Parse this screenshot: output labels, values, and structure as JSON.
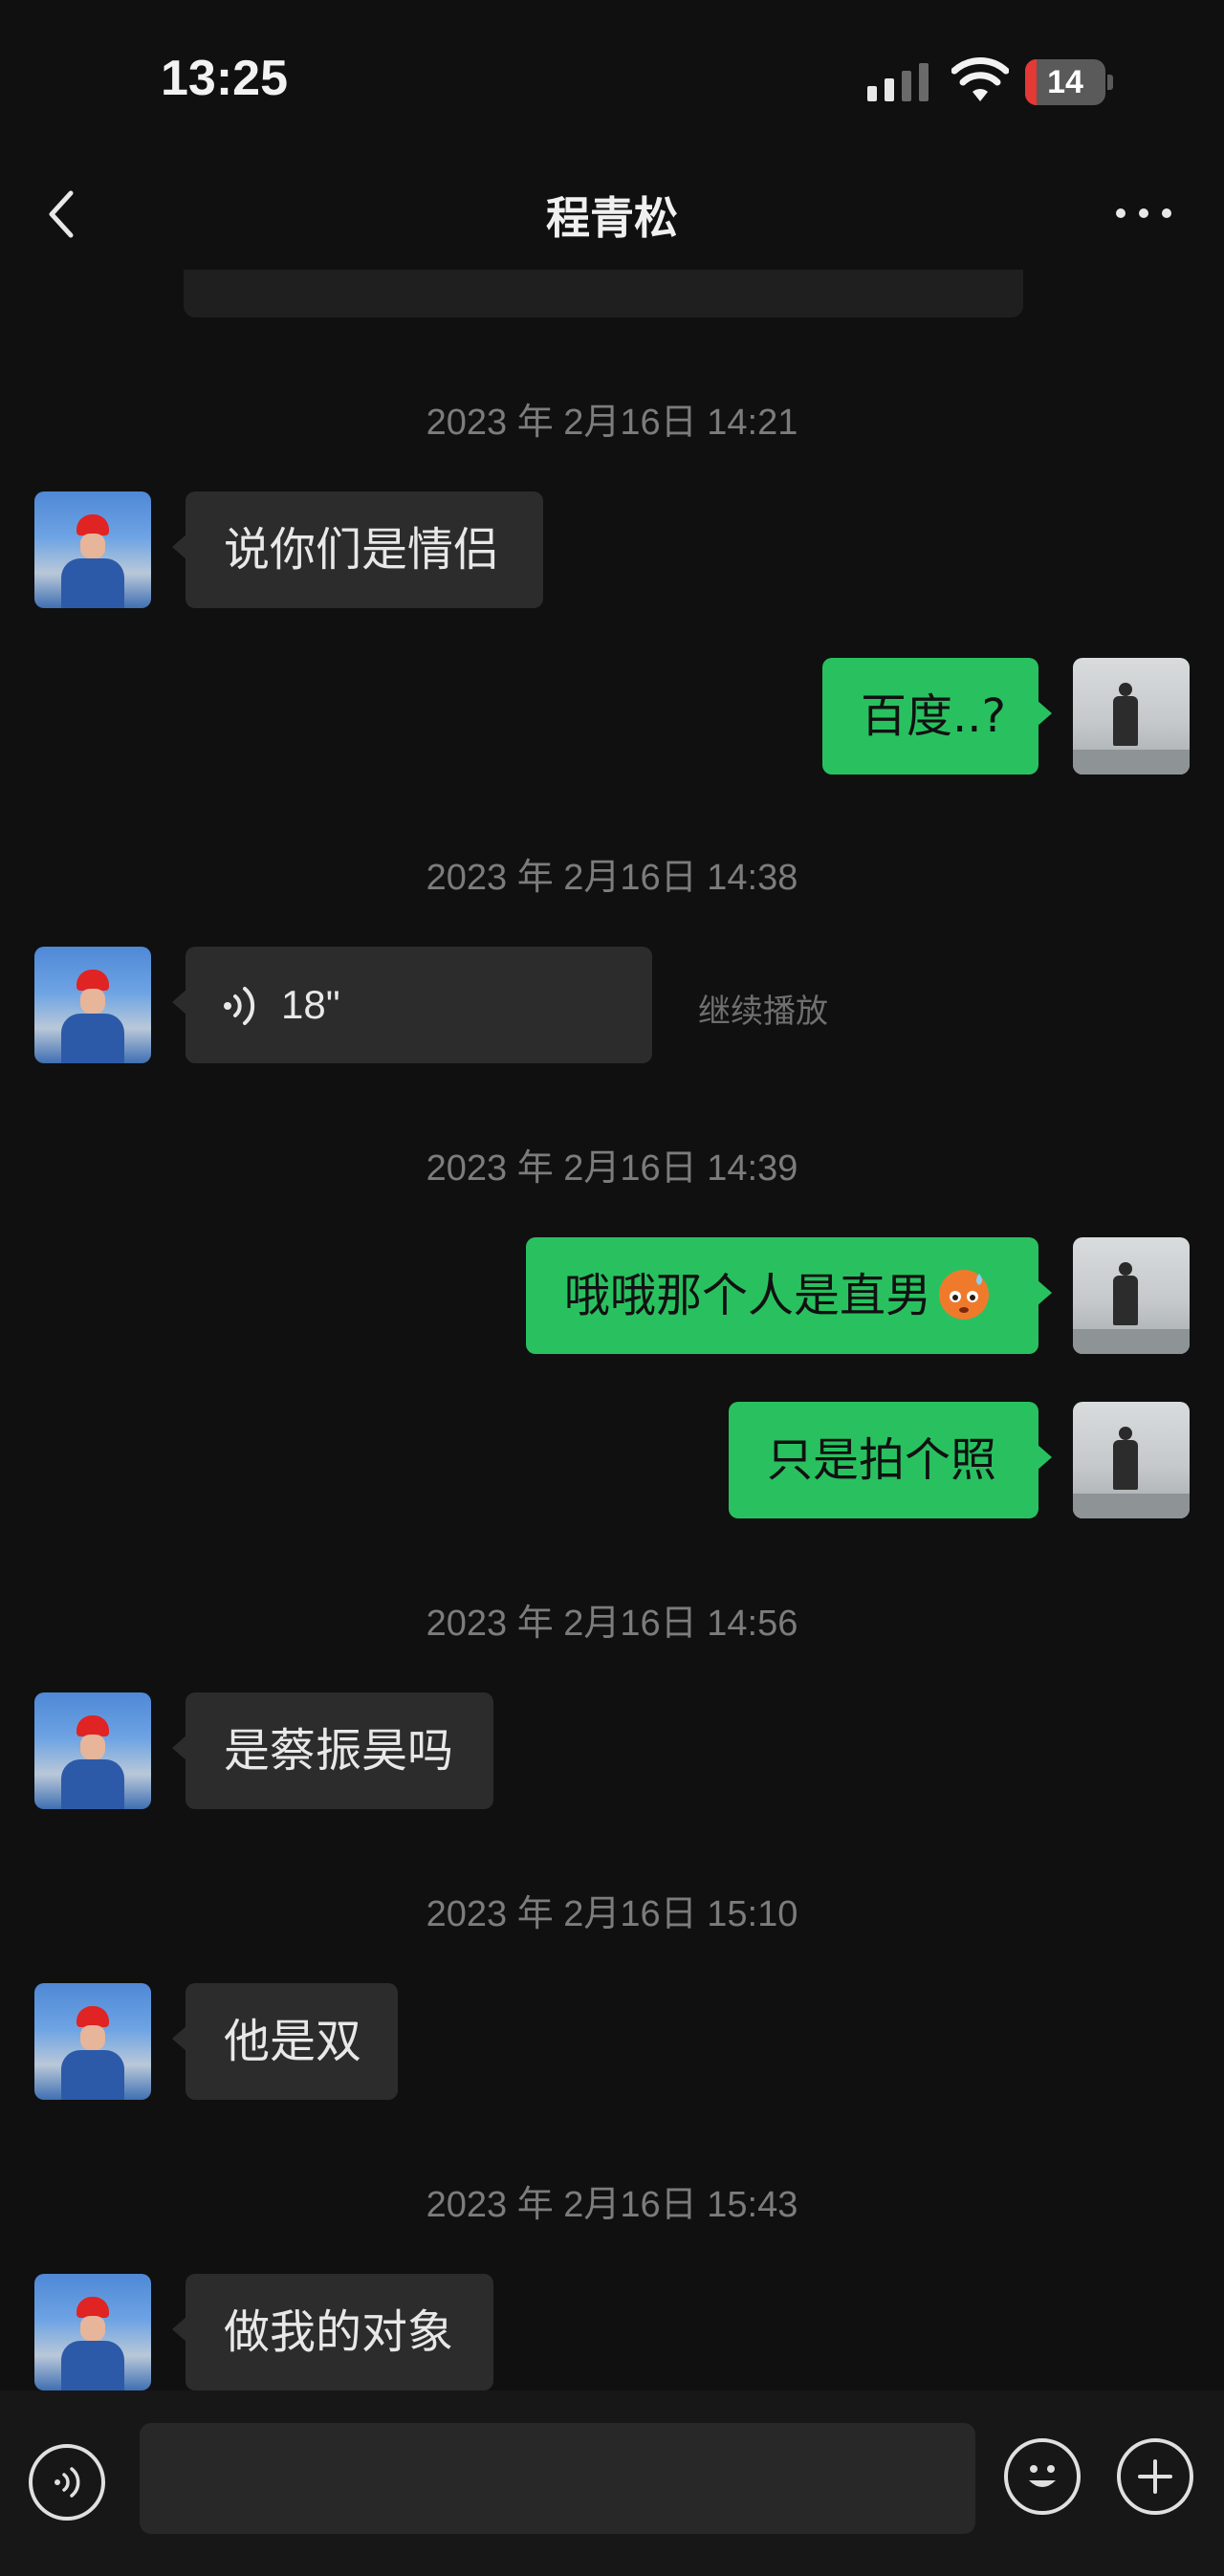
{
  "status_bar": {
    "time": "13:25",
    "battery_level": "14",
    "battery_fraction": 0.14
  },
  "header": {
    "title": "程青松",
    "back_icon": "chevron-left-icon",
    "more_icon": "more-horizontal-icon"
  },
  "messages": {
    "ts1": "2023 年 2月16日 14:21",
    "m1": "说你们是情侣",
    "m2": "百度..?",
    "ts2": "2023 年 2月16日 14:38",
    "voice_duration": "18\"",
    "continue_play": "继续播放",
    "ts3": "2023 年 2月16日 14:39",
    "m4": "哦哦那个人是直男",
    "m4_emoji": "sweat-smile-emoji",
    "m5": "只是拍个照",
    "ts4": "2023 年 2月16日 14:56",
    "m6": "是蔡振昊吗",
    "ts5": "2023 年 2月16日 15:10",
    "m7": "他是双",
    "ts6": "2023 年 2月16日 15:43",
    "m8": "做我的对象"
  },
  "input_bar": {
    "placeholder": "",
    "voice_icon": "voice-mode-icon",
    "emoji_icon": "emoji-icon",
    "plus_icon": "plus-icon"
  },
  "colors": {
    "background": "#101010",
    "bubble_in": "#2c2c2c",
    "bubble_out": "#29c160",
    "timestamp": "#7c7c7c",
    "battery_low": "#e53935"
  }
}
